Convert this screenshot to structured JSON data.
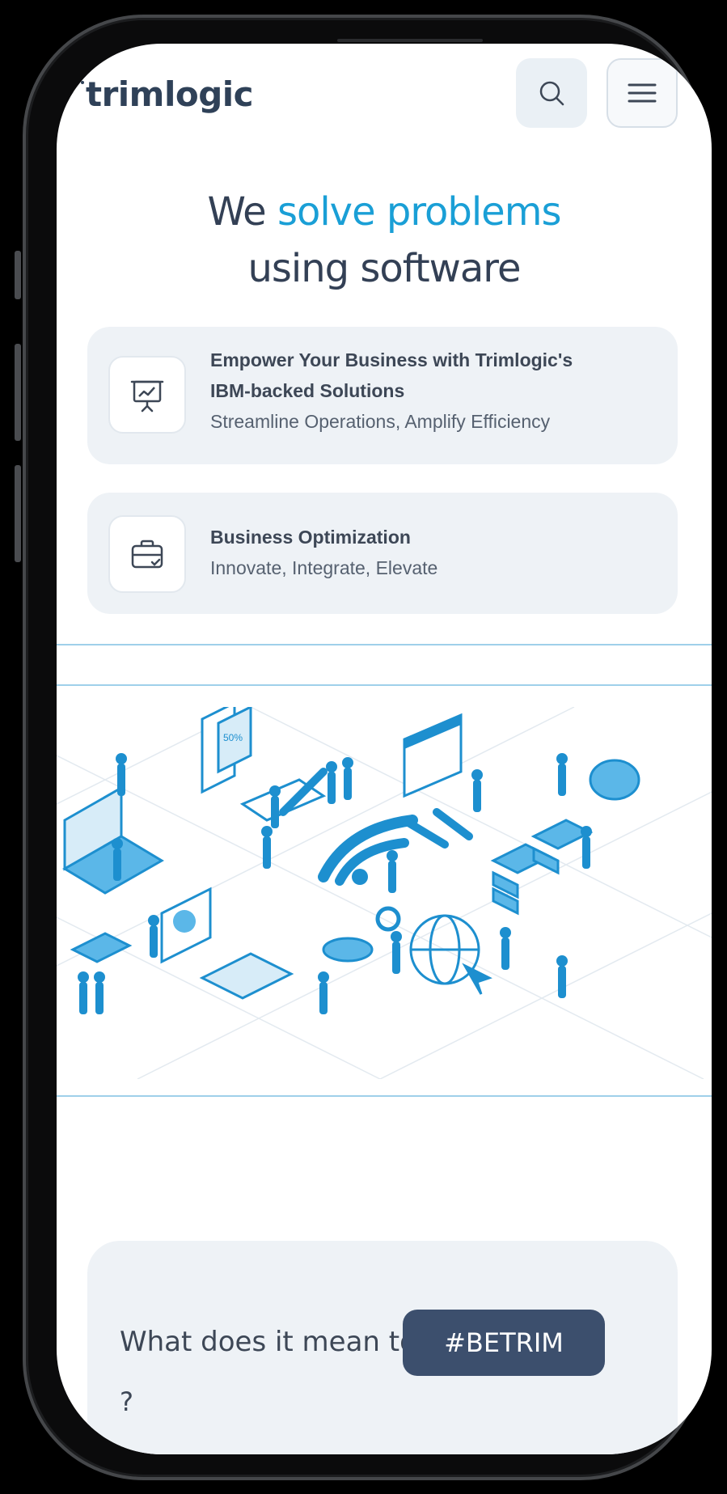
{
  "header": {
    "logo": "trimlogic",
    "search_icon": "search-icon",
    "menu_icon": "hamburger-menu-icon"
  },
  "hero": {
    "line1_prefix": "We ",
    "line1_accent": "solve problems",
    "line2": "using software",
    "accent_color": "#1a9fd6"
  },
  "cards": [
    {
      "icon": "presentation-chart-icon",
      "title_line1": "Empower Your Business with Trimlogic's",
      "title_line2": "IBM-backed Solutions",
      "subtitle": "Streamline Operations, Amplify Efficiency"
    },
    {
      "icon": "briefcase-check-icon",
      "title": "Business Optimization",
      "subtitle": "Innovate, Integrate, Elevate"
    }
  ],
  "illustration": {
    "icon": "isometric-business-tech-illustration",
    "badge": "50%"
  },
  "betrim": {
    "question": "What does it mean to",
    "tag": "#BETRIM",
    "question_mark": "?"
  },
  "colors": {
    "primary_text": "#334055",
    "accent": "#1a9fd6",
    "tag_bg": "#3c4f6d",
    "card_bg": "#eef2f6"
  }
}
